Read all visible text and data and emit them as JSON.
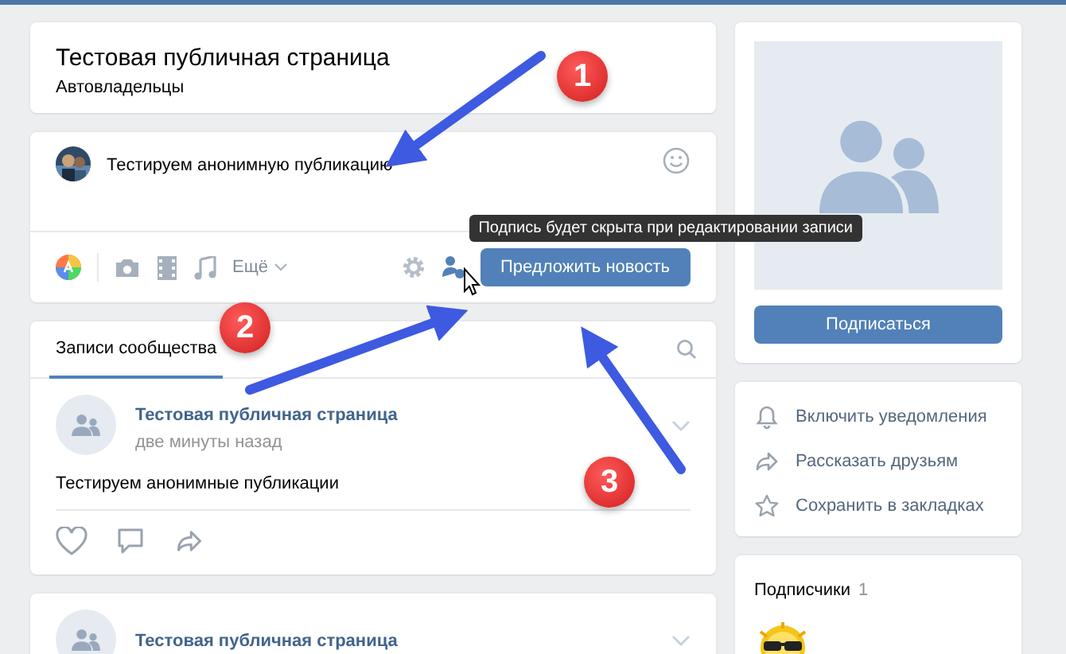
{
  "group": {
    "title": "Тестовая публичная страница",
    "subtitle": "Автовладельцы"
  },
  "composer": {
    "text": "Тестируем анонимную публикацию",
    "more": "Ещё",
    "submit": "Предложить новость",
    "tooltip": "Подпись будет скрыта при редактировании записи"
  },
  "wall": {
    "tabs": [
      {
        "label": "Записи сообщества",
        "selected": true
      }
    ],
    "posts": [
      {
        "author": "Тестовая публичная страница",
        "time": "две минуты назад",
        "text": "Тестируем анонимные публикации"
      },
      {
        "author": "Тестовая публичная страница"
      }
    ]
  },
  "sidebar": {
    "subscribe": "Подписаться",
    "actions": [
      {
        "kind": "bell",
        "label": "Включить уведомления"
      },
      {
        "kind": "share",
        "label": "Рассказать друзьям"
      },
      {
        "kind": "star",
        "label": "Сохранить в закладках"
      }
    ],
    "followers": {
      "label": "Подписчики",
      "count": "1"
    }
  },
  "annotations": [
    {
      "number": "1"
    },
    {
      "number": "2"
    },
    {
      "number": "3"
    }
  ]
}
